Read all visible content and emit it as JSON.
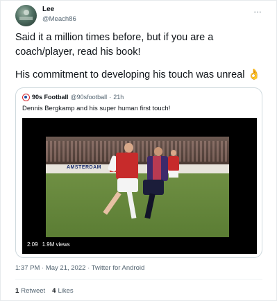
{
  "author": {
    "name": "Lee",
    "handle": "@Meach86",
    "avatar_icon": "profile-avatar"
  },
  "more_icon": "…",
  "tweet": {
    "line1": "Said it a million times before, but if you are a coach/player, read his book!",
    "line2": "His commitment to developing his touch was unreal",
    "emoji": "👌"
  },
  "quoted": {
    "name": "90s Football",
    "handle": "@90sfootball",
    "separator": "·",
    "age": "21h",
    "text": "Dennis Bergkamp and his super human first touch!",
    "video": {
      "duration": "2:09",
      "views": "1.9M views",
      "board_text": "AMSTERDAM"
    }
  },
  "meta": {
    "time": "1:37 PM",
    "separator": "·",
    "date": "May 21, 2022",
    "client": "Twitter for Android"
  },
  "stats": {
    "retweets_count": "1",
    "retweets_label": "Retweet",
    "likes_count": "4",
    "likes_label": "Likes"
  },
  "colors": {
    "text": "#0f1419",
    "secondary": "#536471",
    "border": "#cfd9de"
  }
}
